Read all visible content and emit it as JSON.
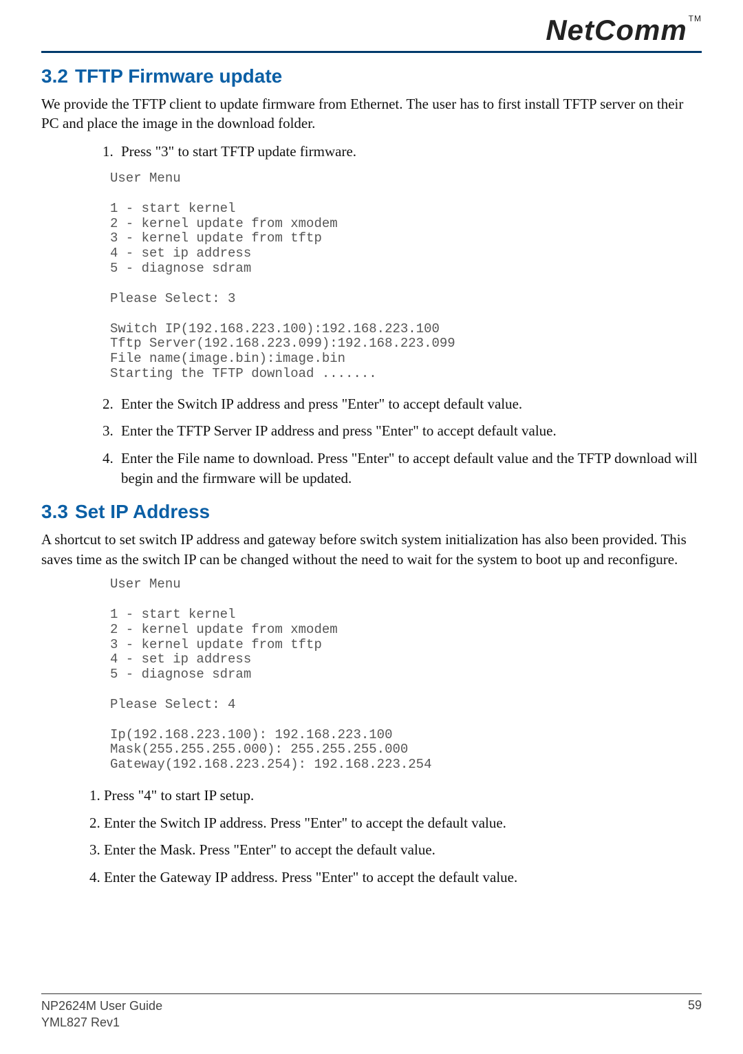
{
  "brand": {
    "name": "NetComm",
    "tm": "TM"
  },
  "section32": {
    "number": "3.2",
    "title": "TFTP Firmware update",
    "intro": "We provide the TFTP client to update firmware from Ethernet.  The user has to first install TFTP server on their PC and place the image in the download folder.",
    "step1": "Press \"3\" to start TFTP update firmware.",
    "terminal": "User Menu\n\n1 - start kernel\n2 - kernel update from xmodem\n3 - kernel update from tftp\n4 - set ip address\n5 - diagnose sdram\n\nPlease Select: 3\n\nSwitch IP(192.168.223.100):192.168.223.100\nTftp Server(192.168.223.099):192.168.223.099\nFile name(image.bin):image.bin\nStarting the TFTP download .......",
    "step2": "Enter the Switch IP address and press \"Enter\" to accept default value.",
    "step3": "Enter the TFTP Server IP address and press \"Enter\" to accept default value.",
    "step4": "Enter the File name to download.  Press \"Enter\" to accept default value and the TFTP download will begin and the firmware will be updated."
  },
  "section33": {
    "number": "3.3",
    "title": "Set IP Address",
    "intro": "A shortcut to set switch IP address and gateway before switch system initialization has also been provided.  This saves time as the switch IP can be changed without the need to wait for the system to boot up and reconfigure.",
    "terminal": "User Menu\n\n1 - start kernel\n2 - kernel update from xmodem\n3 - kernel update from tftp\n4 - set ip address\n5 - diagnose sdram\n\nPlease Select: 4\n\nIp(192.168.223.100): 192.168.223.100\nMask(255.255.255.000): 255.255.255.000\nGateway(192.168.223.254): 192.168.223.254",
    "step1": "1. Press \"4\" to start IP setup.",
    "step2": "2. Enter the Switch IP address. Press \"Enter\" to accept the default value.",
    "step3": "3. Enter the Mask. Press \"Enter\" to accept the default value.",
    "step4": "4. Enter the Gateway IP address. Press \"Enter\" to accept the default value."
  },
  "footer": {
    "guide": "NP2624M User Guide",
    "rev": "YML827 Rev1",
    "page": "59"
  }
}
